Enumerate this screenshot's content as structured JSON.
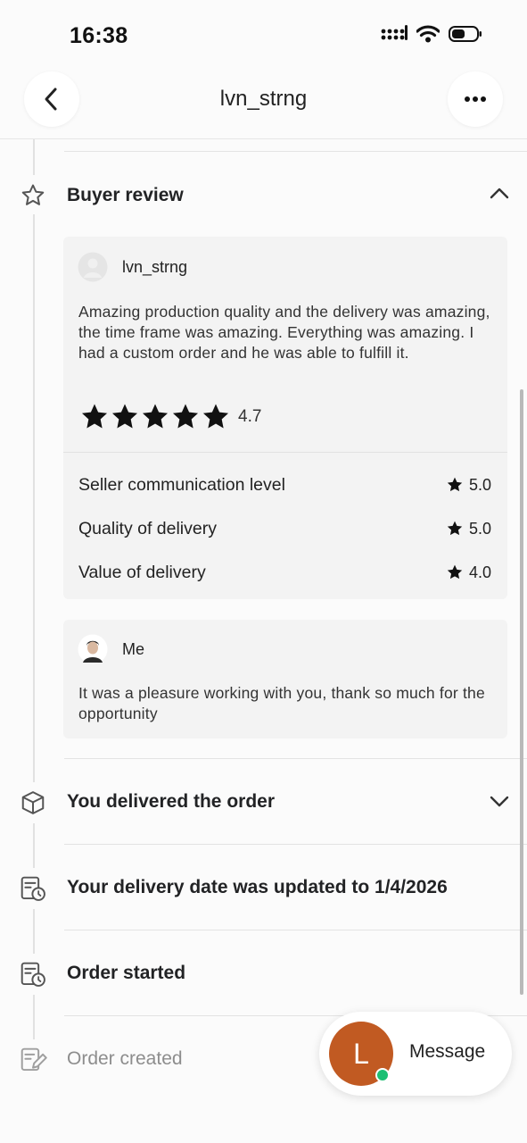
{
  "status_bar": {
    "time": "16:38"
  },
  "header": {
    "title": "lvn_strng",
    "back_icon": "chevron-left-icon",
    "more_icon": "more-horizontal-icon"
  },
  "buyer_review": {
    "title": "Buyer review",
    "icon": "star-outline-icon",
    "collapse_icon": "chevron-up-icon",
    "review": {
      "author": "lvn_strng",
      "text": "Amazing production quality and the delivery was amazing, the time frame was amazing. Everything was amazing. I had a custom order and he was able to fulfill it.",
      "stars": 5,
      "rating": "4.7",
      "metrics": [
        {
          "label": "Seller communication level",
          "score": "5.0"
        },
        {
          "label": "Quality of delivery",
          "score": "5.0"
        },
        {
          "label": "Value of delivery",
          "score": "4.0"
        }
      ]
    },
    "reply": {
      "author": "Me",
      "text": "It was a pleasure working with you, thank so much for the opportunity"
    }
  },
  "timeline": [
    {
      "title": "You delivered the order",
      "icon": "package-icon",
      "expand_icon": "chevron-down-icon"
    },
    {
      "title": "Your delivery date was updated to 1/4/2026",
      "icon": "calendar-clock-icon"
    },
    {
      "title": "Order started",
      "icon": "calendar-clock-icon"
    },
    {
      "title": "Order created",
      "icon": "edit-document-icon"
    }
  ],
  "message_button": {
    "label": "Message",
    "avatar_initial": "L",
    "avatar_color": "#c15a22",
    "online_color": "#1dbf73"
  }
}
